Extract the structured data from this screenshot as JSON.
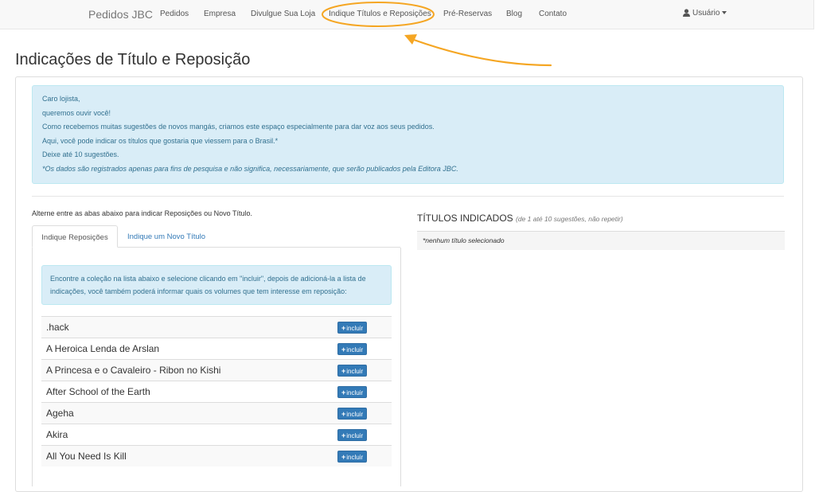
{
  "navbar": {
    "brand": "Pedidos JBC",
    "items": [
      {
        "label": "Pedidos"
      },
      {
        "label": "Empresa"
      },
      {
        "label": "Divulgue Sua Loja"
      },
      {
        "label": "Indique Títulos e Reposições"
      },
      {
        "label": "Pré-Reservas"
      },
      {
        "label": "Blog"
      },
      {
        "label": "Contato"
      }
    ],
    "user_label": "Usuário",
    "user_icon": "user-icon"
  },
  "annotation": {
    "color": "#f5a623"
  },
  "page": {
    "title": "Indicações de Título e Reposição"
  },
  "intro": {
    "lines": [
      "Caro lojista,",
      "queremos ouvir você!",
      "Como recebemos muitas sugestões de novos mangás, criamos este espaço especialmente para dar voz aos seus pedidos.",
      "Aqui, você pode indicar os títulos que gostaria que viessem para o Brasil.*",
      "Deixe até 10 sugestões."
    ],
    "note": "*Os dados são registrados apenas para fins de pesquisa e não significa, necessariamente, que serão publicados pela Editora JBC."
  },
  "left": {
    "instruction": "Alterne entre as abas abaixo para indicar Reposições ou Novo Título.",
    "tabs": [
      {
        "label": "Indique Reposições"
      },
      {
        "label": "Indique um Novo Título"
      }
    ],
    "tab_help": "Encontre a coleção na lista abaixo e selecione clicando em \"incluir\", depois de adicioná-la a lista de indicações, você também poderá informar quais os volumes que tem interesse em reposição:",
    "include_label": "incluir",
    "titles": [
      ".hack",
      "A Heroica Lenda de Arslan",
      "A Princesa e o Cavaleiro - Ribon no Kishi",
      "After School of the Earth",
      "Ageha",
      "Akira",
      "All You Need Is Kill"
    ]
  },
  "right": {
    "title": "TÍTULOS INDICADOS",
    "subtitle": "(de 1 até 10 sugestões, não repetir)",
    "empty": "*nenhum título selecionado"
  },
  "colors": {
    "accent": "#337ab7",
    "info_bg": "#d9edf7",
    "info_text": "#31708f"
  }
}
